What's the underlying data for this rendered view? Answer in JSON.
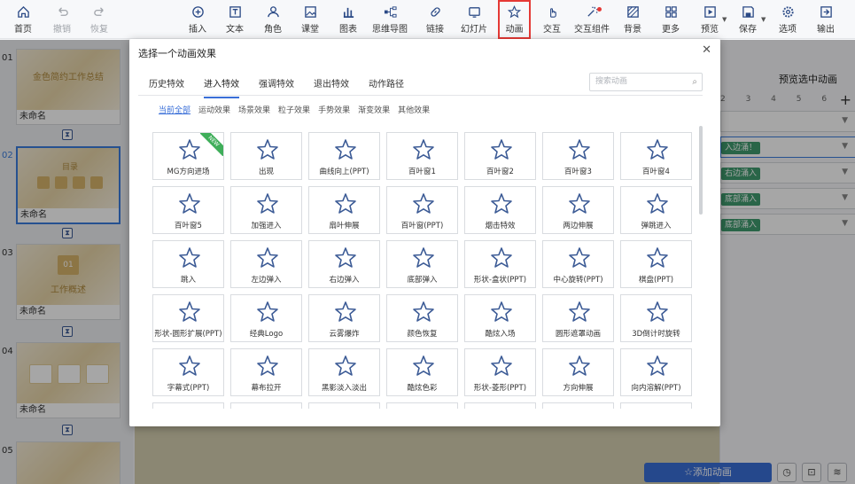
{
  "toolbar": {
    "items": [
      {
        "label": "首页",
        "icon": "home-icon"
      },
      {
        "label": "撤销",
        "icon": "undo-icon"
      },
      {
        "label": "恢复",
        "icon": "redo-icon"
      },
      {
        "label": "插入",
        "icon": "plus-circle-icon"
      },
      {
        "label": "文本",
        "icon": "text-icon"
      },
      {
        "label": "角色",
        "icon": "person-icon"
      },
      {
        "label": "课堂",
        "icon": "image-icon"
      },
      {
        "label": "图表",
        "icon": "chart-icon"
      },
      {
        "label": "思维导图",
        "icon": "mindmap-icon"
      },
      {
        "label": "链接",
        "icon": "link-icon"
      },
      {
        "label": "幻灯片",
        "icon": "slides-icon"
      },
      {
        "label": "动画",
        "icon": "star-icon"
      },
      {
        "label": "交互",
        "icon": "hand-icon"
      },
      {
        "label": "交互组件",
        "icon": "magic-icon"
      },
      {
        "label": "背景",
        "icon": "background-icon"
      },
      {
        "label": "更多",
        "icon": "grid-icon"
      },
      {
        "label": "预览",
        "icon": "preview-icon"
      },
      {
        "label": "保存",
        "icon": "save-icon"
      },
      {
        "label": "选项",
        "icon": "gear-icon"
      },
      {
        "label": "输出",
        "icon": "export-icon"
      }
    ]
  },
  "slides": [
    {
      "num": "01",
      "caption": "未命名",
      "title": "金色简约工作总结"
    },
    {
      "num": "02",
      "caption": "未命名",
      "title": "目录"
    },
    {
      "num": "03",
      "caption": "未命名",
      "title": "工作概述",
      "badge": "01"
    },
    {
      "num": "04",
      "caption": "未命名",
      "title": ""
    },
    {
      "num": "05",
      "caption": "",
      "title": ""
    }
  ],
  "right_panel": {
    "preview_label": "预览选中动画",
    "ruler": "2 3 4 5 6",
    "tags": [
      "入边涌！",
      "右边涌入",
      "底部涌入",
      "底部涌入"
    ],
    "add_button": "添加动画"
  },
  "modal": {
    "title": "选择一个动画效果",
    "tabs": [
      "历史特效",
      "进入特效",
      "强调特效",
      "退出特效",
      "动作路径"
    ],
    "active_tab": 1,
    "search_placeholder": "搜索动画",
    "subtabs": [
      "当前全部",
      "运动效果",
      "场景效果",
      "粒子效果",
      "手势效果",
      "渐变效果",
      "其他效果"
    ],
    "active_subtab": 0,
    "new_badge": "NEW",
    "effects": [
      [
        "MG方向进场",
        "出现",
        "曲线向上(PPT)",
        "百叶窗1",
        "百叶窗2",
        "百叶窗3",
        "百叶窗4"
      ],
      [
        "百叶窗5",
        "加强进入",
        "扇叶伸展",
        "百叶窗(PPT)",
        "烟击特效",
        "两边伸展",
        "弹跳进入"
      ],
      [
        "跳入",
        "左边弹入",
        "右边弹入",
        "底部弹入",
        "形状-盒状(PPT)",
        "中心旋转(PPT)",
        "棋盘(PPT)"
      ],
      [
        "形状-圆形扩展(PPT)",
        "经典Logo",
        "云雾爆炸",
        "颜色恢复",
        "酷炫入场",
        "圆形遮罩动画",
        "3D倒计时旋转"
      ],
      [
        "字幕式(PPT)",
        "幕布拉开",
        "黑影淡入淡出",
        "酷炫色彩",
        "形状-菱形(PPT)",
        "方向伸展",
        "向内溶解(PPT)"
      ]
    ],
    "accent_color": "#3a6fd8"
  }
}
